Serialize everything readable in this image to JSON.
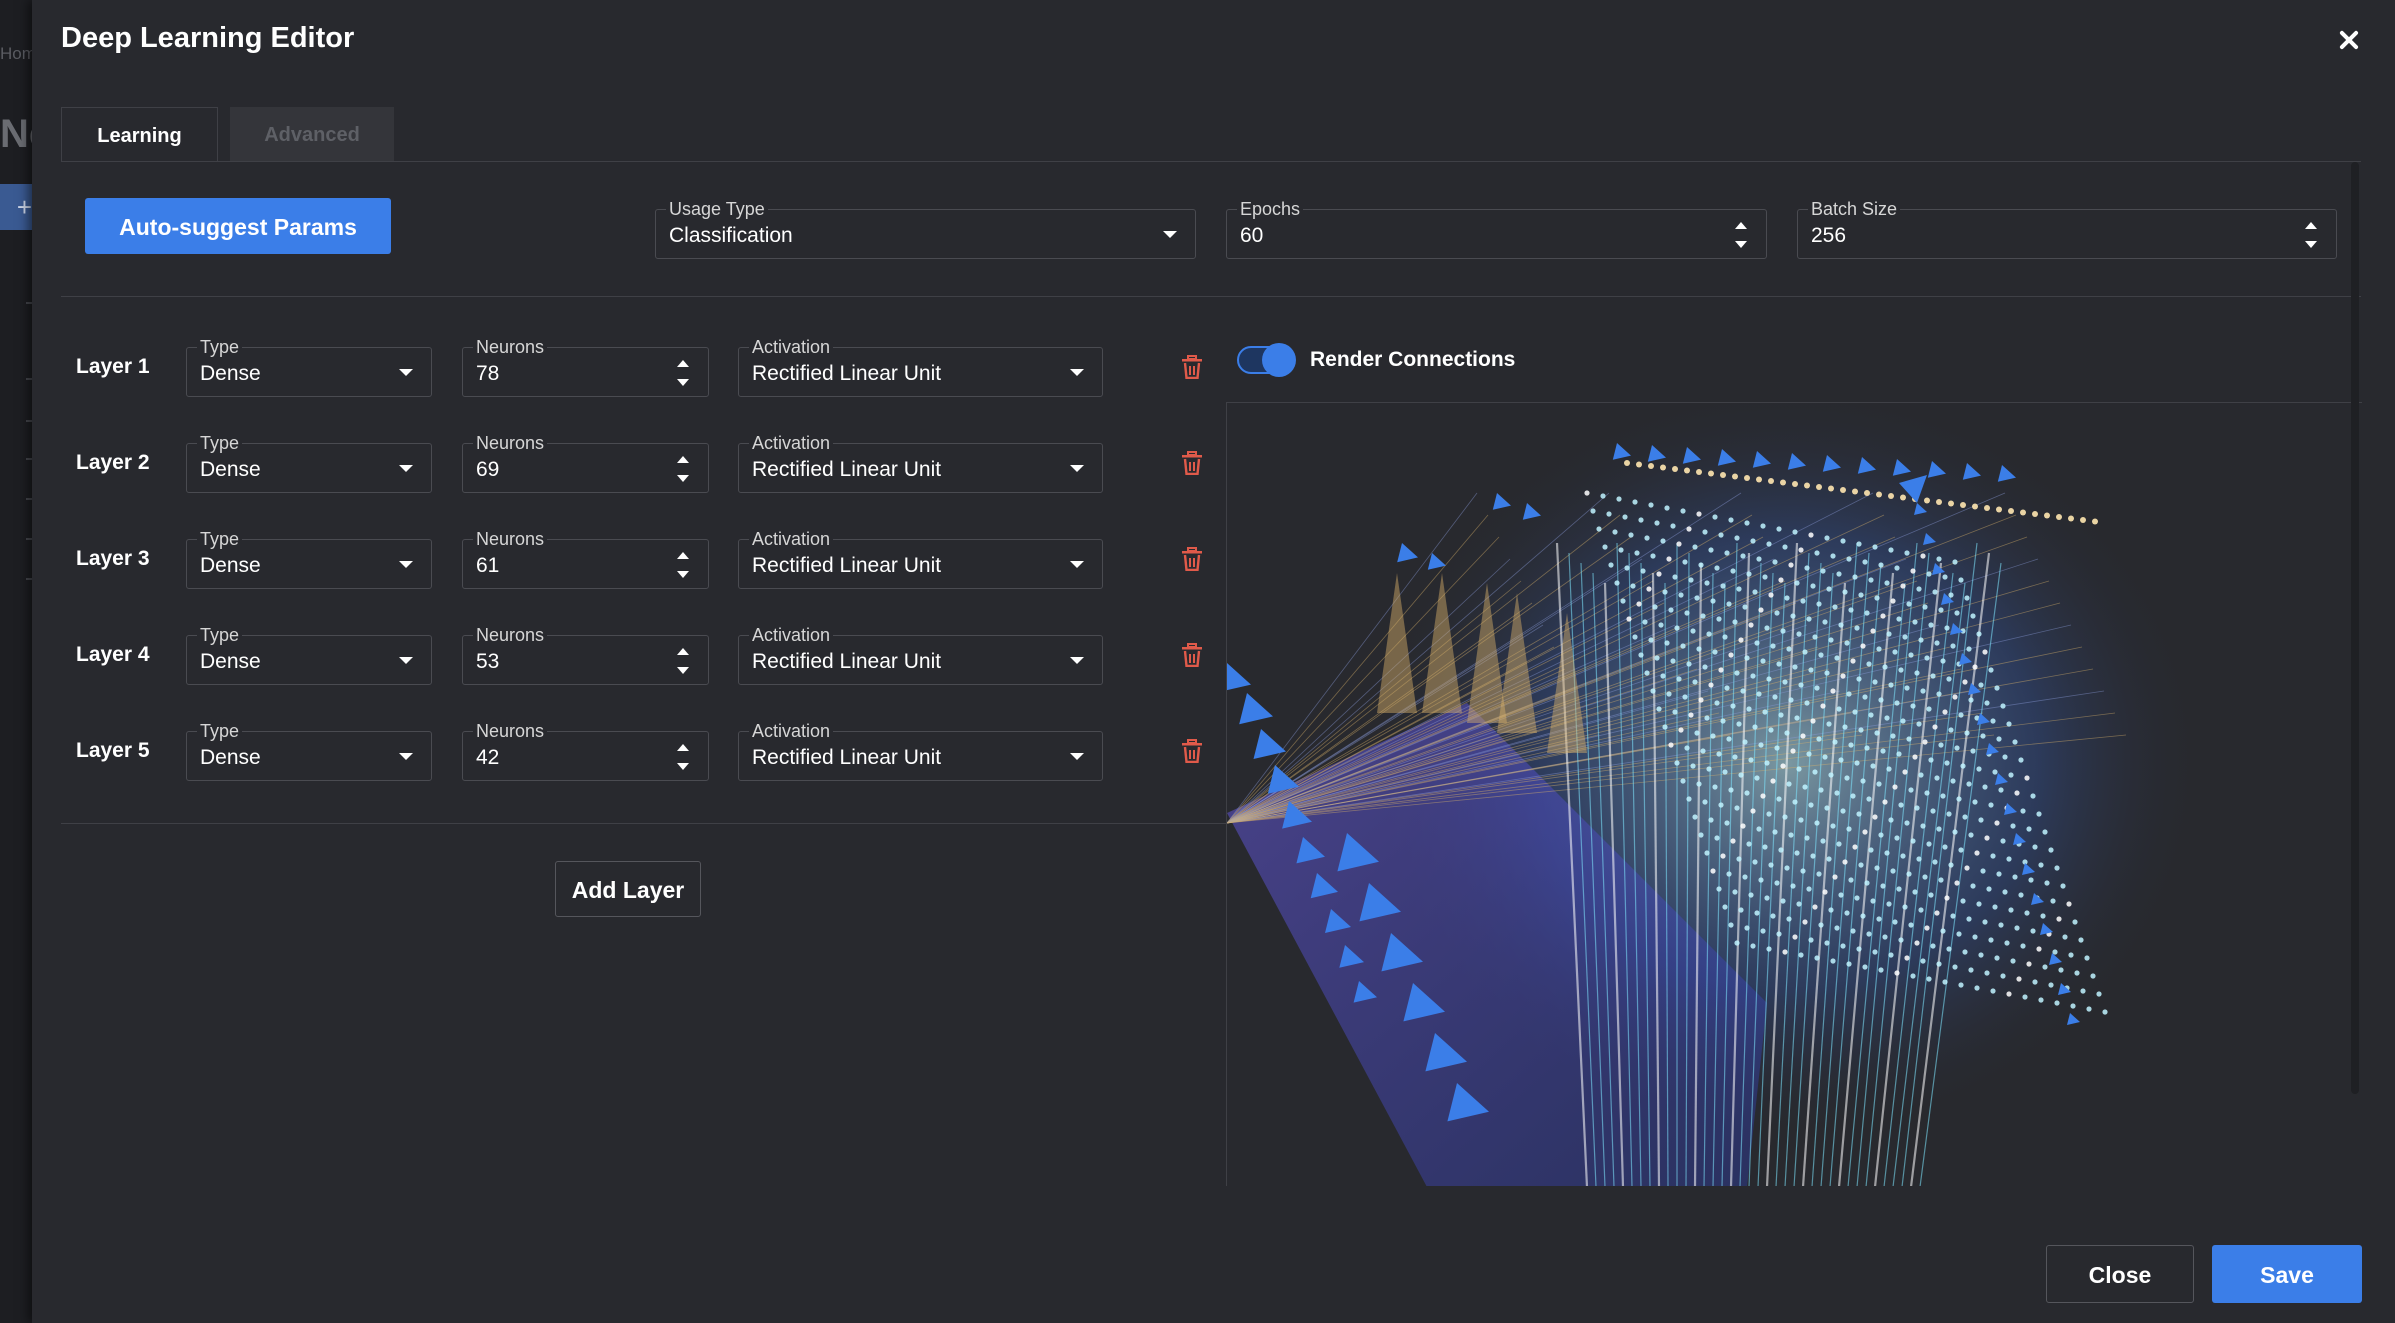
{
  "background": {
    "home_fragment": "Hom",
    "title_fragment": "Ne",
    "plus": "+"
  },
  "dialog": {
    "title": "Deep Learning Editor",
    "tabs": [
      {
        "label": "Learning",
        "active": true
      },
      {
        "label": "Advanced",
        "active": false
      }
    ],
    "auto_suggest_label": "Auto-suggest Params",
    "usage_type": {
      "label": "Usage Type",
      "value": "Classification"
    },
    "epochs": {
      "label": "Epochs",
      "value": "60"
    },
    "batch_size": {
      "label": "Batch Size",
      "value": "256"
    },
    "layers": [
      {
        "name": "Layer 1",
        "type_label": "Type",
        "type": "Dense",
        "neurons_label": "Neurons",
        "neurons": "78",
        "activation_label": "Activation",
        "activation": "Rectified Linear Unit"
      },
      {
        "name": "Layer 2",
        "type_label": "Type",
        "type": "Dense",
        "neurons_label": "Neurons",
        "neurons": "69",
        "activation_label": "Activation",
        "activation": "Rectified Linear Unit"
      },
      {
        "name": "Layer 3",
        "type_label": "Type",
        "type": "Dense",
        "neurons_label": "Neurons",
        "neurons": "61",
        "activation_label": "Activation",
        "activation": "Rectified Linear Unit"
      },
      {
        "name": "Layer 4",
        "type_label": "Type",
        "type": "Dense",
        "neurons_label": "Neurons",
        "neurons": "53",
        "activation_label": "Activation",
        "activation": "Rectified Linear Unit"
      },
      {
        "name": "Layer 5",
        "type_label": "Type",
        "type": "Dense",
        "neurons_label": "Neurons",
        "neurons": "42",
        "activation_label": "Activation",
        "activation": "Rectified Linear Unit"
      }
    ],
    "add_layer_label": "Add Layer",
    "render_connections": {
      "label": "Render Connections",
      "enabled": true
    },
    "close_label": "Close",
    "save_label": "Save"
  },
  "colors": {
    "accent": "#3b7ee8",
    "dialog_bg": "#28292e",
    "delete_icon": "#e05a4a",
    "neuron_glow": "#bff3ff",
    "connection_gold": "#d9b26a"
  },
  "icons": [
    "close-icon",
    "dropdown-caret-icon",
    "spinner-icon",
    "trash-icon"
  ]
}
